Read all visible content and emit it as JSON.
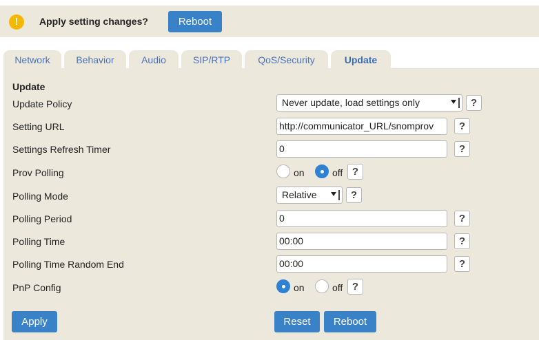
{
  "notice": {
    "icon": "warning-icon",
    "icon_glyph": "!",
    "text": "Apply setting changes?",
    "reboot_label": "Reboot"
  },
  "tabs": [
    {
      "label": "Network",
      "active": false
    },
    {
      "label": "Behavior",
      "active": false
    },
    {
      "label": "Audio",
      "active": false
    },
    {
      "label": "SIP/RTP",
      "active": false
    },
    {
      "label": "QoS/Security",
      "active": false
    },
    {
      "label": "Update",
      "active": true
    }
  ],
  "section_title": "Update",
  "settings": {
    "update_policy": {
      "label": "Update Policy",
      "value": "Never update, load settings only"
    },
    "setting_url": {
      "label": "Setting URL",
      "value": "http://communicator_URL/snomprov"
    },
    "refresh_timer": {
      "label": "Settings Refresh Timer",
      "value": "0"
    },
    "prov_polling": {
      "label": "Prov Polling",
      "on_label": "on",
      "off_label": "off",
      "selected": "off"
    },
    "polling_mode": {
      "label": "Polling Mode",
      "value": "Relative"
    },
    "polling_period": {
      "label": "Polling Period",
      "value": "0"
    },
    "polling_time": {
      "label": "Polling Time",
      "value": "00:00"
    },
    "polling_time_random_end": {
      "label": "Polling Time Random End",
      "value": "00:00"
    },
    "pnp_config": {
      "label": "PnP Config",
      "on_label": "on",
      "off_label": "off",
      "selected": "on"
    }
  },
  "help_label": "?",
  "actions": {
    "apply_label": "Apply",
    "reset_label": "Reset",
    "reboot_label": "Reboot"
  },
  "colors": {
    "accent": "#3a82c8",
    "panel": "#ece8dc",
    "tab_text": "#4a72b8",
    "warning": "#f5b800"
  }
}
